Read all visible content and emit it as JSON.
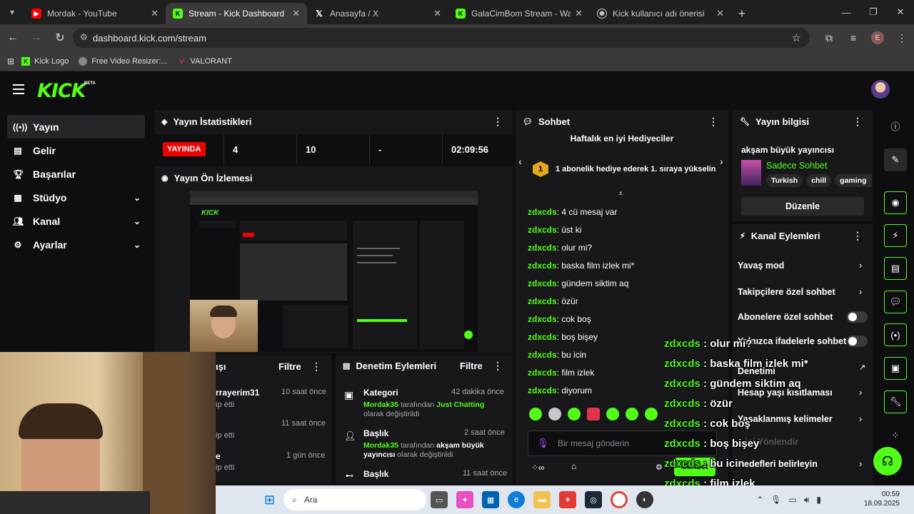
{
  "browser": {
    "tabs": [
      {
        "title": "Mordak - YouTube",
        "favicon": "youtube-icon",
        "color": "#ff0000"
      },
      {
        "title": "Stream - Kick Dashboard",
        "favicon": "kick-icon",
        "color": "#53fc18"
      },
      {
        "title": "Anasayfa / X",
        "favicon": "x-icon",
        "color": "#ffffff"
      },
      {
        "title": "GalaCimBom Stream - Watch Li",
        "favicon": "kick-icon",
        "color": "#53fc18"
      },
      {
        "title": "Kick kullanıcı adı önerisi",
        "favicon": "chatgpt-icon",
        "color": "#ffffff"
      }
    ],
    "url": "dashboard.kick.com/stream",
    "profile_initial": "E",
    "bookmarks": [
      {
        "label": "Kick Logo",
        "icon": "kick-icon"
      },
      {
        "label": "Free Video Resizer:...",
        "icon": "globe-icon"
      },
      {
        "label": "VALORANT",
        "icon": "valorant-icon"
      }
    ]
  },
  "kick": {
    "logo_text": "KICK",
    "beta": "BETA",
    "sidebar": [
      {
        "label": "Yayın",
        "icon": "broadcast-icon",
        "active": true
      },
      {
        "label": "Gelir",
        "icon": "chart-icon"
      },
      {
        "label": "Başarılar",
        "icon": "trophy-icon"
      },
      {
        "label": "Stüdyo",
        "icon": "grid-icon",
        "expandable": true
      },
      {
        "label": "Kanal",
        "icon": "users-icon",
        "expandable": true
      },
      {
        "label": "Ayarlar",
        "icon": "gear-icon",
        "expandable": true
      }
    ],
    "stats": {
      "title": "Yayın İstatistikleri",
      "live_badge": "YAYINDA",
      "viewers": "4",
      "followers": "10",
      "subs": "-",
      "uptime": "02:09:56"
    },
    "preview": {
      "title": "Yayın Ön İzlemesi"
    },
    "activity": {
      "filter_label": "Filtre",
      "items": [
        {
          "name": "rrayerim31",
          "time": "10 saat önce",
          "detail": "ip etti"
        },
        {
          "name": "",
          "time": "11 saat önce",
          "detail": "ip etti"
        },
        {
          "name": "e",
          "time": "1 gün önce",
          "detail": "ip etti"
        }
      ],
      "title_fragment": "ışı"
    },
    "moderation": {
      "title": "Denetim Eylemleri",
      "filter_label": "Filtre",
      "items": [
        {
          "title": "Kategori",
          "time": "42 dakika önce",
          "user": "Mordak35",
          "mid": "tarafından",
          "value": "Just Chatting",
          "suffix": "olarak değiştirildi"
        },
        {
          "title": "Başlık",
          "time": "2 saat önce",
          "user": "Mordak35",
          "mid": "tarafından",
          "value": "akşam büyük yayıncısı",
          "suffix": "olarak değiştirildi"
        },
        {
          "title": "Başlık",
          "time": "11 saat önce"
        }
      ]
    },
    "chat": {
      "title": "Sohbet",
      "gifters_title": "Haftalık en iyi Hediyeciler",
      "gifter_rank": "1",
      "gifter_text": "1 abonelik hediye ederek 1. sıraya yükselin",
      "messages": [
        {
          "user": "zdxcds",
          "text": "4 cü mesaj var"
        },
        {
          "user": "zdxcds",
          "text": "üst ki"
        },
        {
          "user": "zdxcds",
          "text": "olur mi?"
        },
        {
          "user": "zdxcds",
          "text": "baska film izlek mi*"
        },
        {
          "user": "zdxcds",
          "text": "gündem siktim aq"
        },
        {
          "user": "zdxcds",
          "text": "özür"
        },
        {
          "user": "zdxcds",
          "text": "cok boş"
        },
        {
          "user": "zdxcds",
          "text": "boş bişey"
        },
        {
          "user": "zdxcds",
          "text": "bu icin"
        },
        {
          "user": "zdxcds",
          "text": "film izlek"
        },
        {
          "user": "zdxcds",
          "text": "diyorum"
        }
      ],
      "input_placeholder": "Bir mesaj gönderin",
      "send_label": "Sohbet"
    },
    "stream_info": {
      "title": "Yayın bilgisi",
      "stream_title": "akşam büyük yayıncısı",
      "category": "Sadece Sohbet",
      "tags": [
        "Turkish",
        "chill",
        "gaming"
      ],
      "edit_label": "Düzenle"
    },
    "channel_actions": {
      "title": "Kanal Eylemleri",
      "rows": [
        {
          "label": "Yavaş mod",
          "kind": "chevron"
        },
        {
          "label": "Takipçilere özel sohbet",
          "kind": "chevron"
        },
        {
          "label": "Abonelere özel sohbet",
          "kind": "toggle"
        },
        {
          "label": "Yalnızca ifadelerle sohbet",
          "kind": "toggle"
        },
        {
          "label": "Denetimi",
          "kind": "external"
        },
        {
          "label": "Hesap yaşı kısıtlaması",
          "kind": "chevron"
        },
        {
          "label": "Yasaklanmış kelimeler",
          "kind": "chevron"
        },
        {
          "label": "...ici Yönlendir",
          "kind": "none"
        },
        {
          "label": "Hedefleri belirleyin",
          "kind": "chevron"
        }
      ]
    }
  },
  "overlay_chat": [
    {
      "user": "zdxcds",
      "text": "olur mi?"
    },
    {
      "user": "zdxcds",
      "text": "baska film izlek mi*"
    },
    {
      "user": "zdxcds",
      "text": "gündem siktim aq"
    },
    {
      "user": "zdxcds",
      "text": "özür"
    },
    {
      "user": "zdxcds",
      "text": "cok boş"
    },
    {
      "user": "zdxcds",
      "text": "boş bişey"
    },
    {
      "user": "zdxcds",
      "text": "bu icin"
    },
    {
      "user": "zdxcds",
      "text": "film izlek"
    },
    {
      "user": "zdxcds",
      "text": "diyorum"
    }
  ],
  "taskbar": {
    "search_label": "Ara",
    "time": "00:59",
    "date": "18.09.2025"
  },
  "colors": {
    "accent": "#53fc18",
    "live": "#eb0400",
    "panel": "#18181b",
    "bg": "#0e0e10"
  }
}
